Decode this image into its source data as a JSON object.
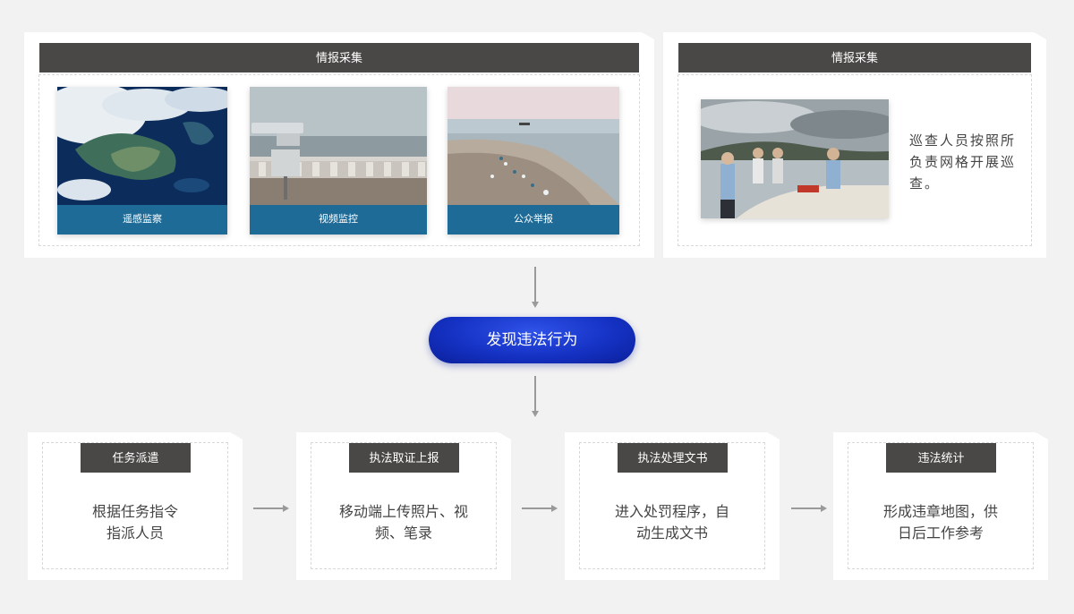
{
  "top_left": {
    "header": "情报采集",
    "photos": [
      {
        "caption": "遥感监察",
        "icon": "satellite-image"
      },
      {
        "caption": "视频监控",
        "icon": "camera-image"
      },
      {
        "caption": "公众举报",
        "icon": "beach-image"
      }
    ]
  },
  "top_right": {
    "header": "情报采集",
    "description": "巡查人员按照所负责网格开展巡查。",
    "icon": "patrol-boat-image"
  },
  "center_node": {
    "label": "发现违法行为"
  },
  "steps": [
    {
      "header": "任务派遣",
      "text_line1": "根据任务指令",
      "text_line2": "指派人员"
    },
    {
      "header": "执法取证上报",
      "text_line1": "移动端上传照片、视",
      "text_line2": "频、笔录"
    },
    {
      "header": "执法处理文书",
      "text_line1": "进入处罚程序，自",
      "text_line2": "动生成文书"
    },
    {
      "header": "违法统计",
      "text_line1": "形成违章地图，供",
      "text_line2": "日后工作参考"
    }
  ],
  "colors": {
    "header_bg": "#4a4846",
    "caption_bg": "#1f6b97",
    "pill": "#1532c4",
    "arrow": "#9a9a9a"
  }
}
